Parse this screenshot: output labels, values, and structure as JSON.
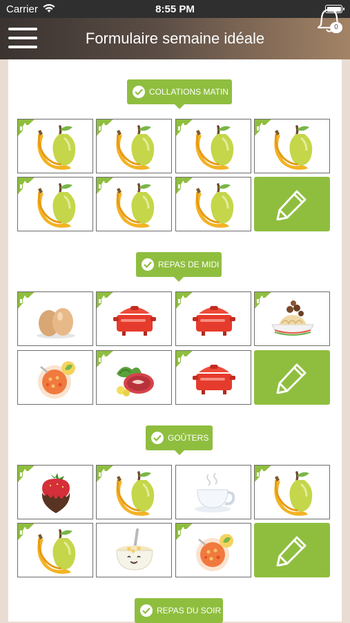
{
  "status_bar": {
    "carrier": "Carrier",
    "time": "8:55 PM"
  },
  "header": {
    "title": "Formulaire semaine idéale",
    "notification_count": "0"
  },
  "sections": [
    {
      "title": "COLLATIONS MATIN",
      "tiles": [
        "fruit",
        "fruit",
        "fruit",
        "fruit",
        "fruit",
        "fruit",
        "fruit",
        "edit"
      ]
    },
    {
      "title": "REPAS DE MIDI",
      "tiles": [
        "eggs",
        "casserole",
        "casserole",
        "pasta",
        "soup",
        "meat",
        "casserole",
        "edit"
      ]
    },
    {
      "title": "GOÛTERS",
      "tiles": [
        "chocolate-strawberry",
        "fruit",
        "tea",
        "fruit",
        "fruit",
        "yogurt",
        "soup",
        "edit"
      ]
    },
    {
      "title": "REPAS DU SOIR"
    }
  ]
}
